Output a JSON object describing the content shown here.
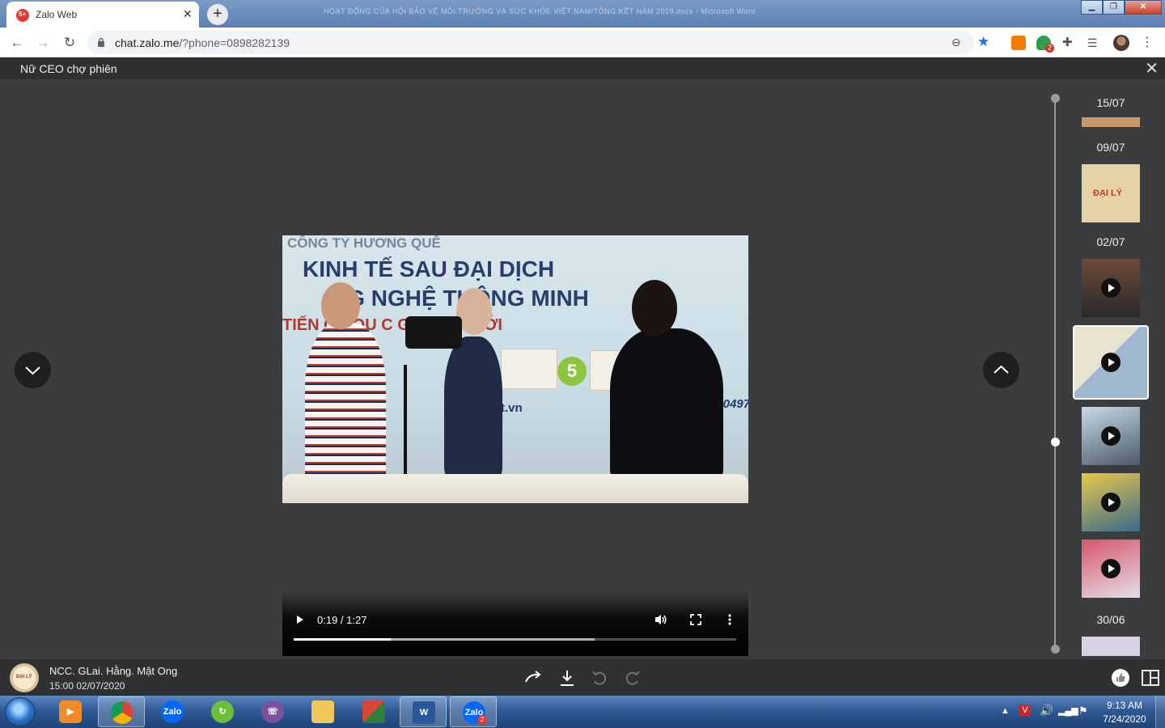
{
  "browser": {
    "tab_title": "Zalo Web",
    "tab_badge": "5+",
    "window_title": "HOẠT ĐỘNG CỦA HỘI BẢO VỆ MÔI TRƯỜNG VÀ SỨC KHỎE VIỆT NAM/TỔNG KẾT NĂM 2019.docx - Microsoft Word",
    "url_host": "chat.zalo.me",
    "url_path": "/?phone=0898282139",
    "extension_badge": "2",
    "colors": {
      "accent": "#1a73e8",
      "badge": "#d93025"
    }
  },
  "viewer": {
    "title": "Nữ CEO chợ phiên",
    "video": {
      "current_time": "0:19 / 1:27",
      "played_fraction": 0.22,
      "buffered_fraction": 0.68,
      "frame_text": {
        "line1": "CÔNG TY HƯƠNG QUÊ",
        "line2": "KINH TẾ SAU ĐẠI DỊCH",
        "line3": "NG NGHỆ THÔNG MINH",
        "line4": "TIẾN  ỘC QU   C GIA THẾ GIỚI",
        "line5": "160497",
        "line6": "t.vn",
        "badge_number": "5"
      }
    },
    "timeline": {
      "dates": [
        "15/07",
        "09/07",
        "02/07",
        "30/06"
      ],
      "thumb_text": {
        "daily": "ĐẠI LÝ"
      }
    }
  },
  "info_bar": {
    "sender_name": "NCC. GLai. Hằng. Mật Ong",
    "sent_time": "15:00 02/07/2020",
    "avatar_text": "ĐẠI LÝ"
  },
  "taskbar": {
    "zalo_badge": "2",
    "zalo_label": "Zalo",
    "clock_time": "9:13 AM",
    "clock_date": "7/24/2020"
  }
}
